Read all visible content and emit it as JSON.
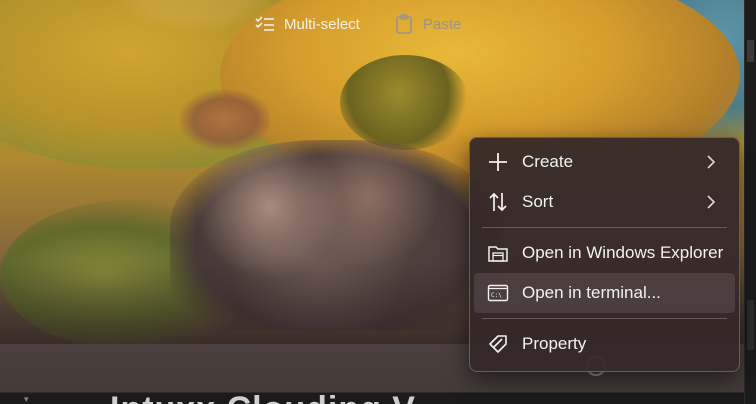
{
  "command_bar": {
    "multiselect": {
      "label": "Multi-select",
      "icon": "multiselect-icon"
    },
    "paste": {
      "label": "Paste",
      "icon": "clipboard-icon",
      "enabled": false
    },
    "more": {
      "icon": "more-icon"
    }
  },
  "context_menu": {
    "items": [
      {
        "label": "Create",
        "icon": "plus-icon",
        "submenu": true
      },
      {
        "label": "Sort",
        "icon": "sort-icon",
        "submenu": true
      },
      {
        "label": "Open in Windows Explorer",
        "icon": "folder-window-icon",
        "submenu": false
      },
      {
        "label": "Open in terminal...",
        "icon": "terminal-icon",
        "submenu": false,
        "hovered": true
      },
      {
        "label": "Property",
        "icon": "tag-icon",
        "submenu": false
      }
    ]
  },
  "background_text": {
    "partial_heading": "Intuxx Clouding V..."
  },
  "colors": {
    "menu_background": "#342828",
    "menu_text": "#f2f2f2",
    "command_bar": "#4e4442"
  }
}
